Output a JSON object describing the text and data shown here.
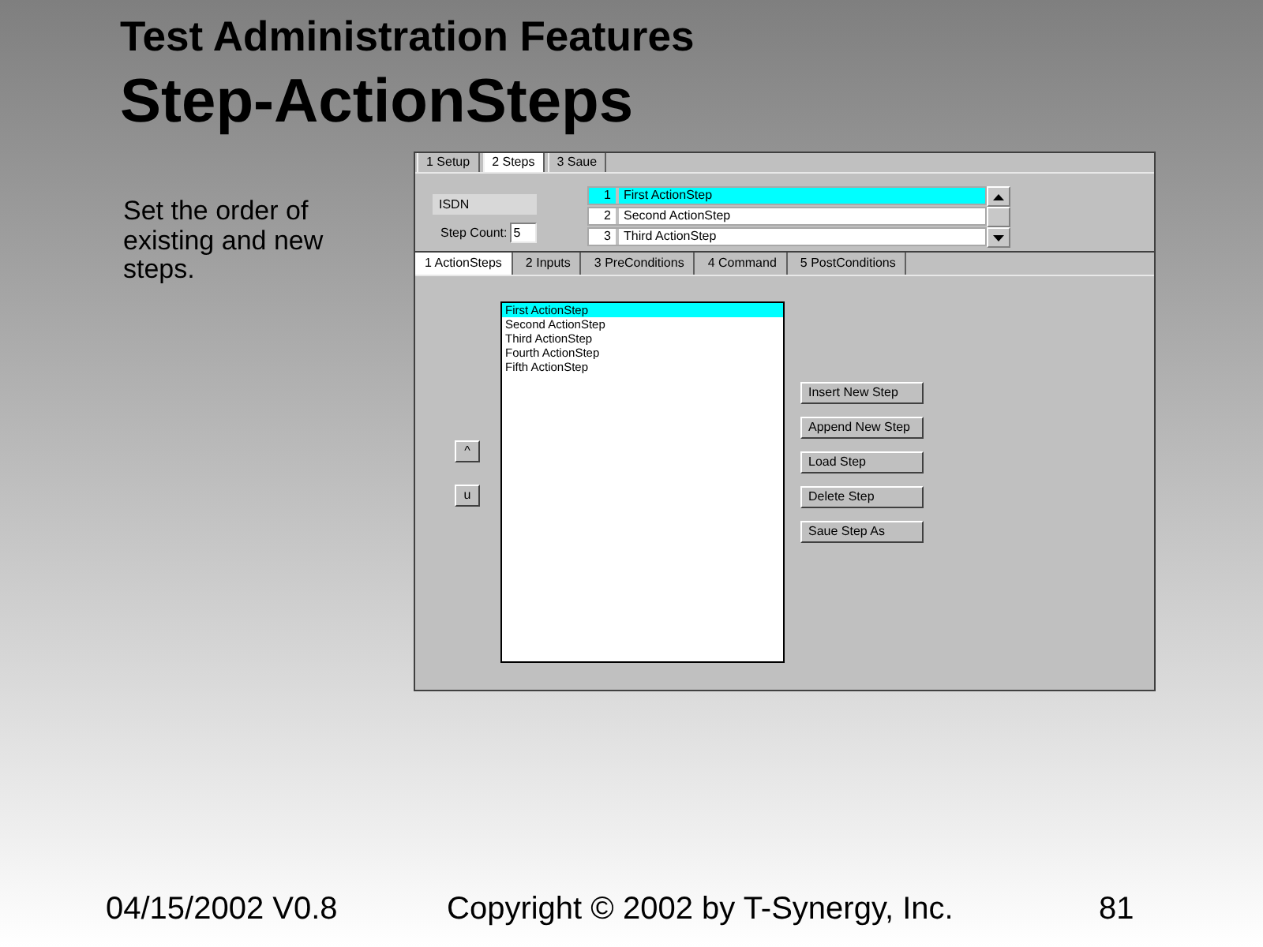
{
  "slide": {
    "heading": "Test Administration Features",
    "title": "Step-ActionSteps",
    "body": "Set the order of existing and new steps."
  },
  "window": {
    "tabs": [
      {
        "label": "1 Setup",
        "selected": false
      },
      {
        "label": "2 Steps",
        "selected": true
      },
      {
        "label": "3 Saue",
        "selected": false
      }
    ],
    "protocol_field": {
      "value": "ISDN"
    },
    "step_count": {
      "label": "Step Count:",
      "value": "5"
    },
    "step_list": [
      {
        "number": "1",
        "name": "First ActionStep",
        "selected": true
      },
      {
        "number": "2",
        "name": "Second ActionStep",
        "selected": false
      },
      {
        "number": "3",
        "name": "Third ActionStep",
        "selected": false
      }
    ],
    "step_tabs": [
      {
        "label": "1 ActionSteps",
        "selected": true
      },
      {
        "label": "2 Inputs",
        "selected": false
      },
      {
        "label": "3 PreConditions",
        "selected": false
      },
      {
        "label": "4 Command",
        "selected": false
      },
      {
        "label": "5 PostConditions",
        "selected": false
      }
    ],
    "move_buttons": [
      "^",
      "u"
    ],
    "action_steps": [
      {
        "label": "First ActionStep",
        "selected": true
      },
      {
        "label": "Second ActionStep",
        "selected": false
      },
      {
        "label": "Third ActionStep",
        "selected": false
      },
      {
        "label": "Fourth ActionStep",
        "selected": false
      },
      {
        "label": "Fifth ActionStep",
        "selected": false
      }
    ],
    "buttons": [
      "Insert New Step",
      "Append New Step",
      "Load Step",
      "Delete Step",
      "Saue Step As"
    ]
  },
  "footer": {
    "date": "04/15/2002 V0.8",
    "copyright": "Copyright © 2002 by T-Synergy, Inc.",
    "page": "81"
  }
}
